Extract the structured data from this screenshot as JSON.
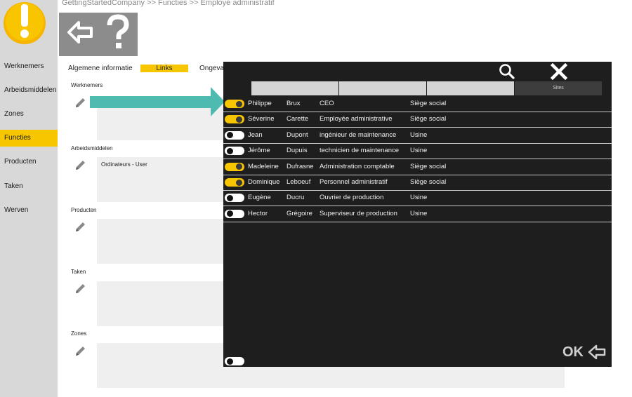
{
  "breadcrumb": "GettingStartedCompany >> Functies >> Employé administratif",
  "colors": {
    "accent": "#f7c600",
    "sidebar": "#d8d8d8",
    "modal_bg": "#1e1e1e",
    "arrow": "#4fbbb0"
  },
  "sidebar": {
    "items": [
      {
        "label": "Werknemers"
      },
      {
        "label": "Arbeidsmiddelen"
      },
      {
        "label": "Zones"
      },
      {
        "label": "Functies",
        "active": true
      },
      {
        "label": "Producten"
      },
      {
        "label": "Taken"
      },
      {
        "label": "Werven"
      }
    ]
  },
  "toolbar": {
    "back_icon": "arrow-left-icon",
    "help_icon": "question-icon"
  },
  "tabs": [
    {
      "label": "Algemene informatie"
    },
    {
      "label": "Links",
      "active": true
    },
    {
      "label": "Ongeva"
    }
  ],
  "sections": [
    {
      "label": "Werknemers",
      "items": []
    },
    {
      "label": "Arbeidsmiddelen",
      "items": [
        "Ordinateurs - User"
      ]
    },
    {
      "label": "Producten",
      "items": []
    },
    {
      "label": "Taken",
      "items": []
    },
    {
      "label": "Zones",
      "items": []
    }
  ],
  "modal": {
    "filter_label": "Sites",
    "ok_label": "OK",
    "rows": [
      {
        "first": "Philippe",
        "last": "Brux",
        "role": "CEO",
        "site": "Siège social",
        "selected": true
      },
      {
        "first": "Séverine",
        "last": "Carette",
        "role": "Employée administrative",
        "site": "Siège social",
        "selected": true
      },
      {
        "first": "Jean",
        "last": "Dupont",
        "role": "ingénieur de maintenance",
        "site": "Usine",
        "selected": false
      },
      {
        "first": "Jérôme",
        "last": "Dupuis",
        "role": "technicien de maintenance",
        "site": "Usine",
        "selected": false
      },
      {
        "first": "Madeleine",
        "last": "Dufrasne",
        "role": "Administration comptable",
        "site": "Siège social",
        "selected": true
      },
      {
        "first": "Dominique",
        "last": "Leboeuf",
        "role": "Personnel administratif",
        "site": "Siège social",
        "selected": true
      },
      {
        "first": "Eugène",
        "last": "Ducru",
        "role": "Ouvrier de production",
        "site": "Usine",
        "selected": false
      },
      {
        "first": "Hector",
        "last": "Grégoire",
        "role": "Superviseur de production",
        "site": "Usine",
        "selected": false
      }
    ],
    "select_all": false
  }
}
